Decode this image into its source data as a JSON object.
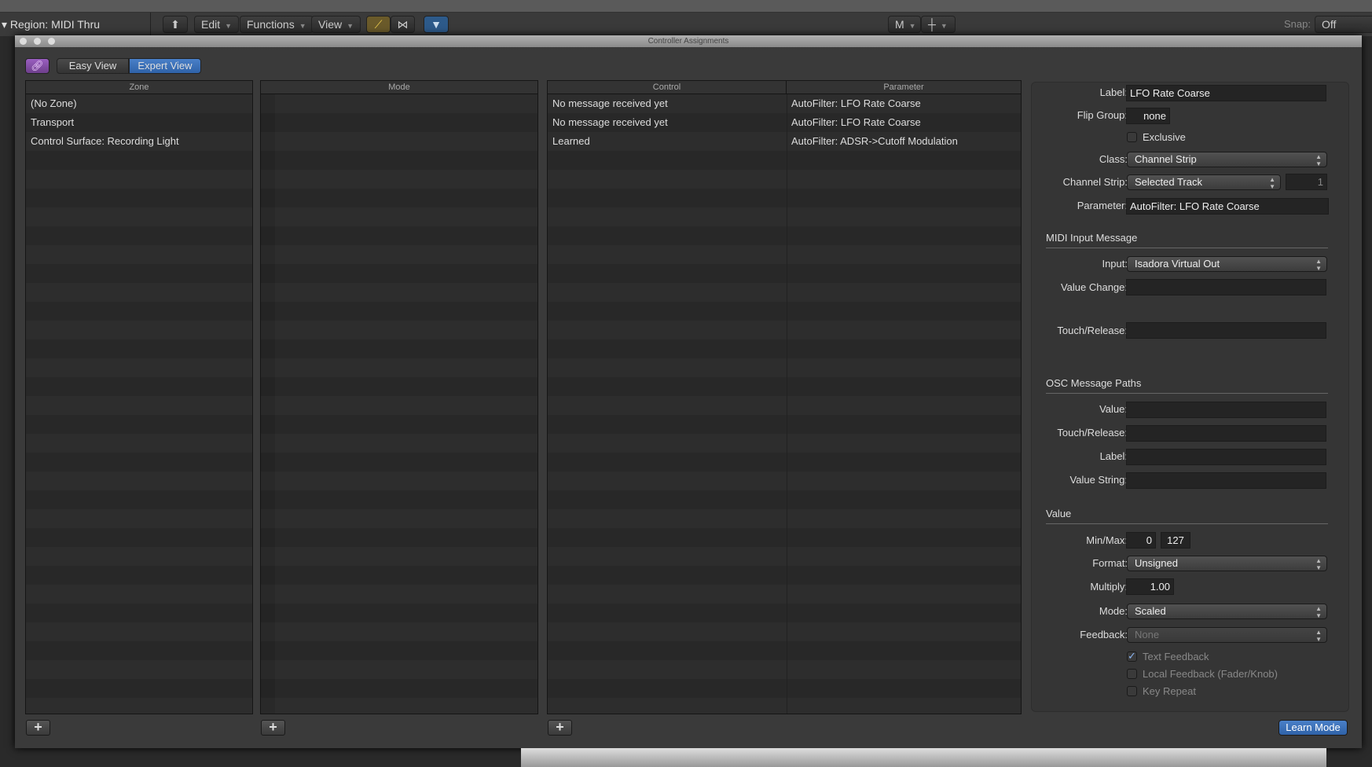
{
  "toolbar": {
    "region": "Region: MIDI Thru",
    "edit": "Edit",
    "functions": "Functions",
    "view": "View",
    "m": "M",
    "snap_label": "Snap:",
    "snap_value": "Off"
  },
  "dialog": {
    "title": "Controller Assignments",
    "easy_view": "Easy View",
    "expert_view": "Expert View",
    "active_view": "Expert View",
    "zone": {
      "header": "Zone",
      "items": [
        "(No Zone)",
        "Transport",
        "Control Surface: Recording Light"
      ]
    },
    "mode": {
      "header": "Mode"
    },
    "control": {
      "headers": [
        "Control",
        "Parameter"
      ],
      "rows": [
        [
          "No message received yet",
          "AutoFilter: LFO Rate Coarse"
        ],
        [
          "No message received yet",
          "AutoFilter: LFO Rate Coarse"
        ],
        [
          "Learned",
          "AutoFilter: ADSR->Cutoff Modulation"
        ]
      ]
    },
    "learn_mode": "Learn Mode"
  },
  "inspector": {
    "label_l": "Label:",
    "label_v": "LFO Rate Coarse",
    "flip_l": "Flip Group:",
    "flip_v": "none",
    "exclusive": "Exclusive",
    "exclusive_checked": false,
    "class_l": "Class:",
    "class_v": "Channel Strip",
    "cs_l": "Channel Strip:",
    "cs_v": "Selected Track",
    "cs_num": "1",
    "param_l": "Parameter:",
    "param_v": "AutoFilter: LFO Rate Coarse",
    "midi_header": "MIDI Input Message",
    "input_l": "Input:",
    "input_v": "Isadora Virtual Out",
    "vc_l": "Value Change:",
    "vc_v": "",
    "tr_l": "Touch/Release:",
    "tr_v": "",
    "osc_header": "OSC Message Paths",
    "osc_value_l": "Value:",
    "osc_tr_l": "Touch/Release:",
    "osc_label_l": "Label:",
    "osc_vs_l": "Value String:",
    "value_header": "Value",
    "minmax_l": "Min/Max:",
    "min": "0",
    "max": "127",
    "format_l": "Format:",
    "format_v": "Unsigned",
    "multiply_l": "Multiply:",
    "multiply_v": "1.00",
    "mode_l": "Mode:",
    "mode_v": "Scaled",
    "feedback_l": "Feedback:",
    "feedback_v": "None",
    "text_feedback": "Text Feedback",
    "text_feedback_checked": true,
    "local_feedback": "Local Feedback (Fader/Knob)",
    "local_feedback_checked": false,
    "key_repeat": "Key Repeat",
    "key_repeat_checked": false
  },
  "colors": {
    "accent": "#3a6fb5",
    "link": "#8a4fa8"
  }
}
